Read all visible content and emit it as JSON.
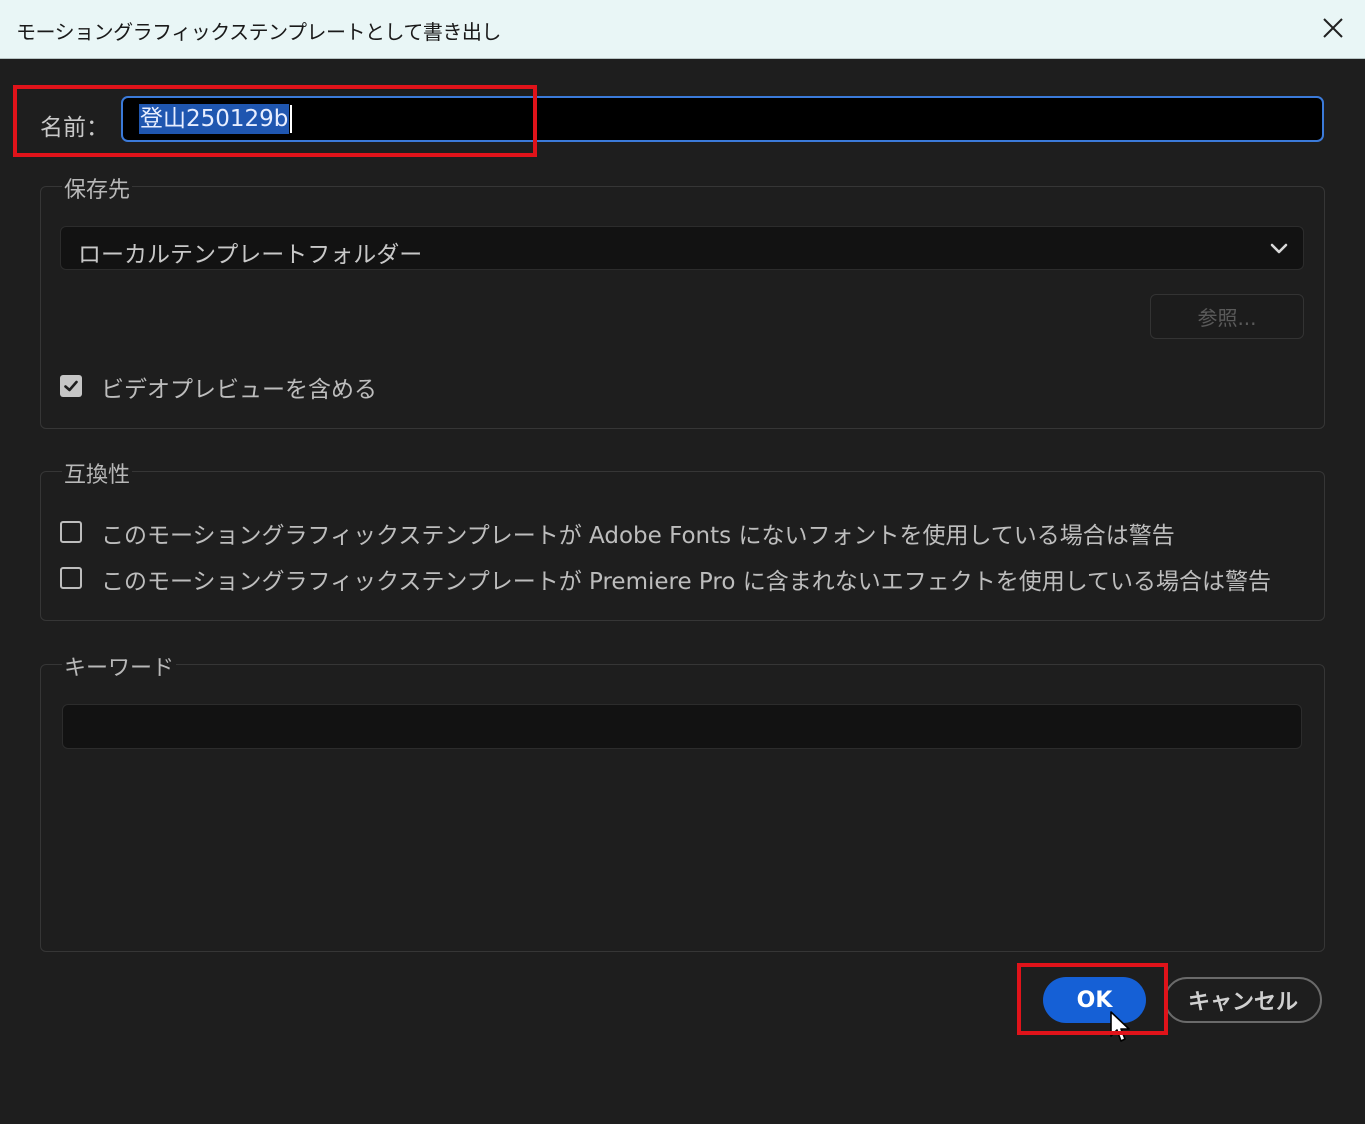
{
  "window": {
    "title": "モーショングラフィックステンプレートとして書き出し"
  },
  "name": {
    "label": "名前：",
    "value": "登山250129b"
  },
  "save_location": {
    "section_label": "保存先",
    "selected": "ローカルテンプレートフォルダー",
    "browse_label": "参照...",
    "include_video_preview": {
      "label": "ビデオプレビューを含める",
      "checked": true
    }
  },
  "compatibility": {
    "section_label": "互換性",
    "options": [
      {
        "label": "このモーショングラフィックステンプレートが Adobe Fonts にないフォントを使用している場合は警告",
        "checked": false
      },
      {
        "label": "このモーショングラフィックステンプレートが Premiere Pro に含まれないエフェクトを使用している場合は警告",
        "checked": false
      }
    ]
  },
  "keywords": {
    "section_label": "キーワード",
    "value": ""
  },
  "buttons": {
    "ok_label": "OK",
    "cancel_label": "キャンセル"
  },
  "colors": {
    "accent": "#1560d6",
    "highlight": "#e0131a",
    "background": "#1e1e1e"
  }
}
